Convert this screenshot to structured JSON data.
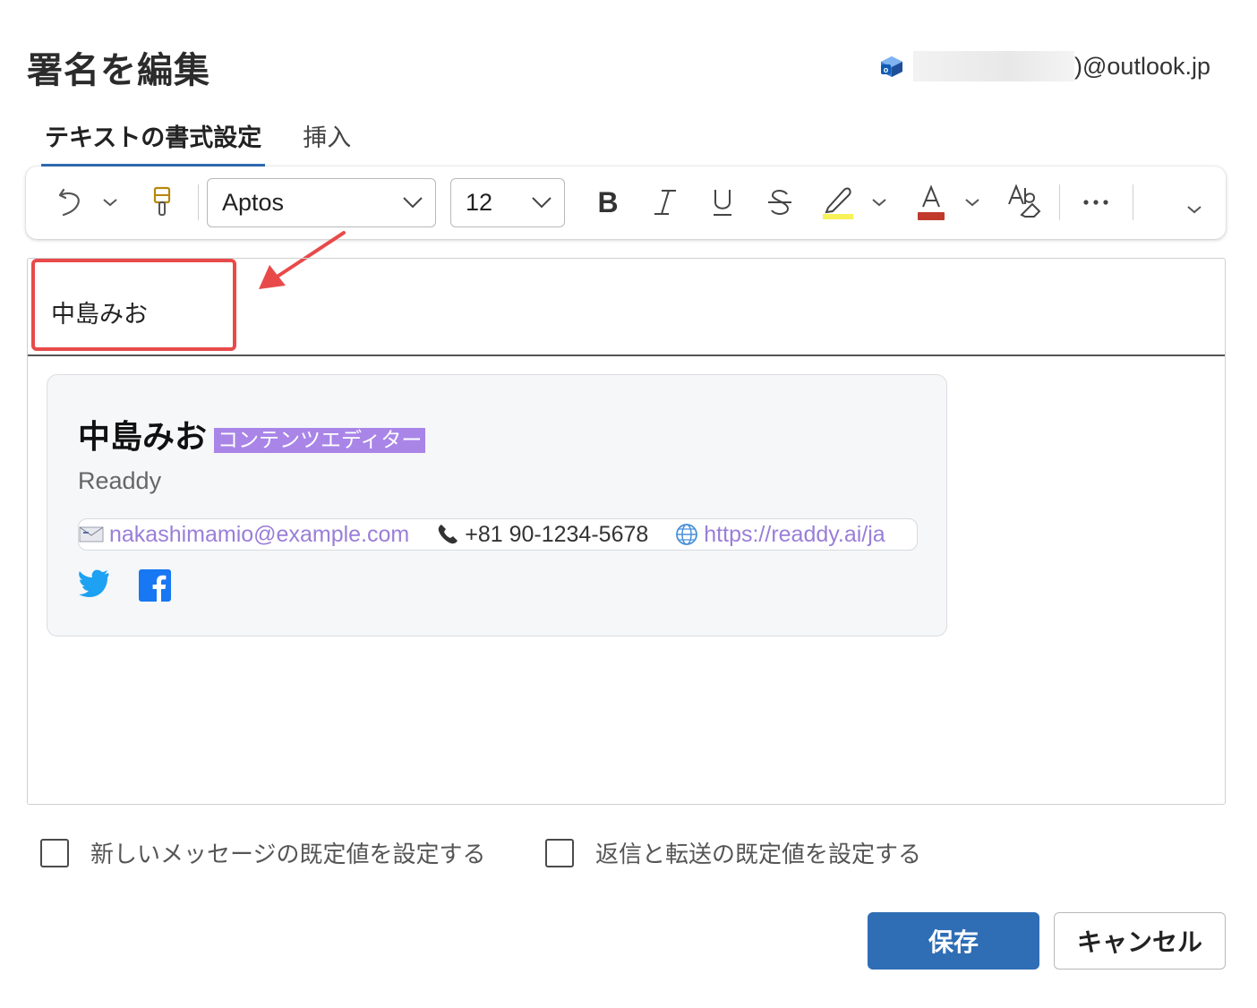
{
  "dialog": {
    "title": "署名を編集",
    "account_domain": ")@outlook.jp"
  },
  "tabs": [
    {
      "label": "テキストの書式設定",
      "active": true
    },
    {
      "label": "挿入",
      "active": false
    }
  ],
  "toolbar": {
    "font": "Aptos",
    "size": "12",
    "highlight_color": "#f7f15a",
    "font_color": "#c0392b",
    "icons": [
      "undo-icon",
      "format-painter-icon",
      "bold-icon",
      "italic-icon",
      "underline-icon",
      "strikethrough-icon",
      "highlighter-icon",
      "font-color-icon",
      "clear-format-icon",
      "more-icon"
    ]
  },
  "editor": {
    "name_line": "中島みお"
  },
  "signature_card": {
    "name": "中島みお",
    "role": "コンテンツエディター",
    "company": "Readdy",
    "email": "nakashimamio@example.com",
    "phone": "+81 90-1234-5678",
    "website": "https://readdy.ai/ja",
    "role_bg_color": "#a985e8",
    "link_color": "#9a7ed8",
    "social": [
      "twitter-icon",
      "facebook-icon"
    ]
  },
  "options": {
    "new_messages_label": "新しいメッセージの既定値を設定する",
    "replies_label": "返信と転送の既定値を設定する"
  },
  "actions": {
    "save_label": "保存",
    "cancel_label": "キャンセル"
  },
  "colors": {
    "primary": "#2f6db5",
    "annotation": "#e84a4a"
  }
}
